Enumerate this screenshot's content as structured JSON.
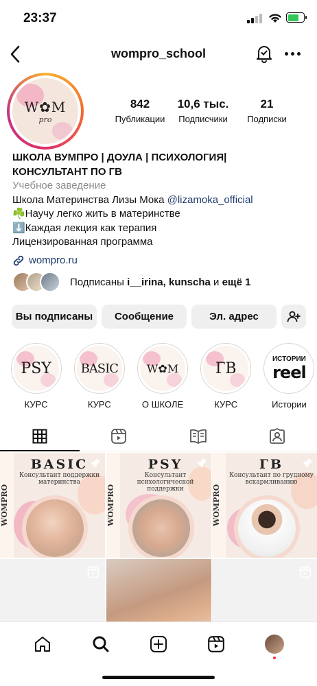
{
  "status": {
    "time": "23:37"
  },
  "header": {
    "username": "wompro_school"
  },
  "avatar": {
    "logo": "W✿M",
    "sub": "pro"
  },
  "stats": [
    {
      "value": "842",
      "label": "Публикации"
    },
    {
      "value": "10,6 тыс.",
      "label": "Подписчики"
    },
    {
      "value": "21",
      "label": "Подписки"
    }
  ],
  "bio": {
    "name_line1": "ШКОЛА ВУМПРО | ДОУЛА | ПСИХОЛОГИЯ|",
    "name_line2": "КОНСУЛЬТАНТ ПО ГВ",
    "category": "Учебное заведение",
    "line1_prefix": "Школа Материнства Лизы Мока ",
    "mention": "@lizamoka_official",
    "line2": "☘️Научу легко жить в материнстве",
    "line3": "⬇️Каждая лекция как терапия",
    "line4": "Лицензированная программа",
    "website": "wompro.ru"
  },
  "followed_by": {
    "prefix": "Подписаны ",
    "names": "i__irina, kunscha",
    "middle": " и ",
    "rest": "ещё 1"
  },
  "buttons": {
    "following": "Вы подписаны",
    "message": "Сообщение",
    "email": "Эл. адрес"
  },
  "highlights": [
    {
      "cover": "PSY",
      "label": "КУРС"
    },
    {
      "cover": "BASIC",
      "label": "КУРС"
    },
    {
      "cover": "W✿M",
      "label": "О ШКОЛЕ"
    },
    {
      "cover": "ГВ",
      "label": "КУРС"
    },
    {
      "cover_top": "ИСТОРИИ",
      "cover": "reel",
      "label": "Истории"
    }
  ],
  "posts": [
    {
      "side": "WOMPRO",
      "title": "BASIC",
      "subtitle": "Консультант поддержки материнства"
    },
    {
      "side": "WOMPRO",
      "title": "PSY",
      "subtitle": "Консультант психологической поддержки"
    },
    {
      "side": "WOMPRO",
      "title": "ГВ",
      "subtitle": "Консультант по грудному вскармливанию"
    }
  ],
  "colors": {
    "link": "#1e3a6e",
    "button_bg": "#efefef",
    "muted": "#8e8e8e"
  }
}
